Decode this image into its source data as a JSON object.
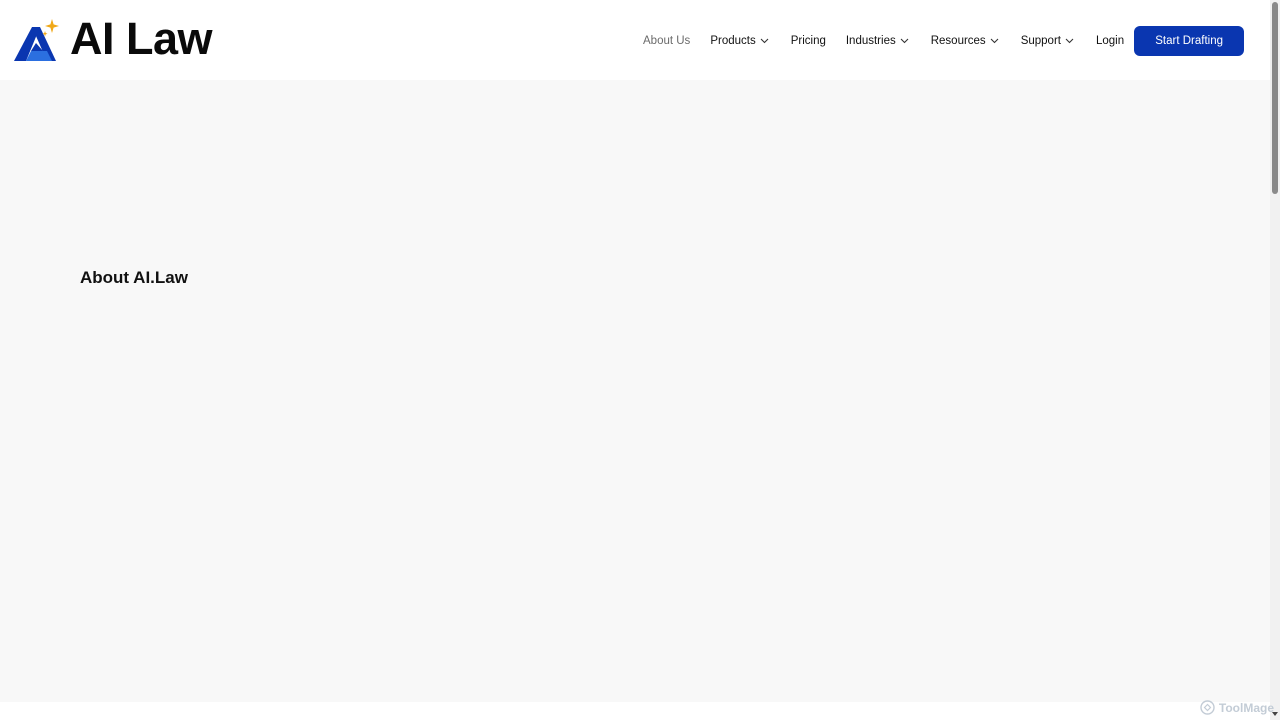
{
  "header": {
    "logo_text": "AI Law",
    "logo_icon": "ai-law-logo-mark",
    "brand_color": "#0a36b0",
    "spark_color": "#f0a818"
  },
  "nav": {
    "items": [
      {
        "label": "About Us",
        "has_dropdown": false,
        "active": true
      },
      {
        "label": "Products",
        "has_dropdown": true
      },
      {
        "label": "Pricing",
        "has_dropdown": false
      },
      {
        "label": "Industries",
        "has_dropdown": true
      },
      {
        "label": "Resources",
        "has_dropdown": true
      },
      {
        "label": "Support",
        "has_dropdown": true
      },
      {
        "label": "Login",
        "has_dropdown": false
      }
    ],
    "cta_label": "Start Drafting",
    "chevron_icon": "chevron-down-icon"
  },
  "main": {
    "title": "About AI.Law",
    "background": "#f8f8f8"
  },
  "watermark": {
    "text": "ToolMage"
  }
}
